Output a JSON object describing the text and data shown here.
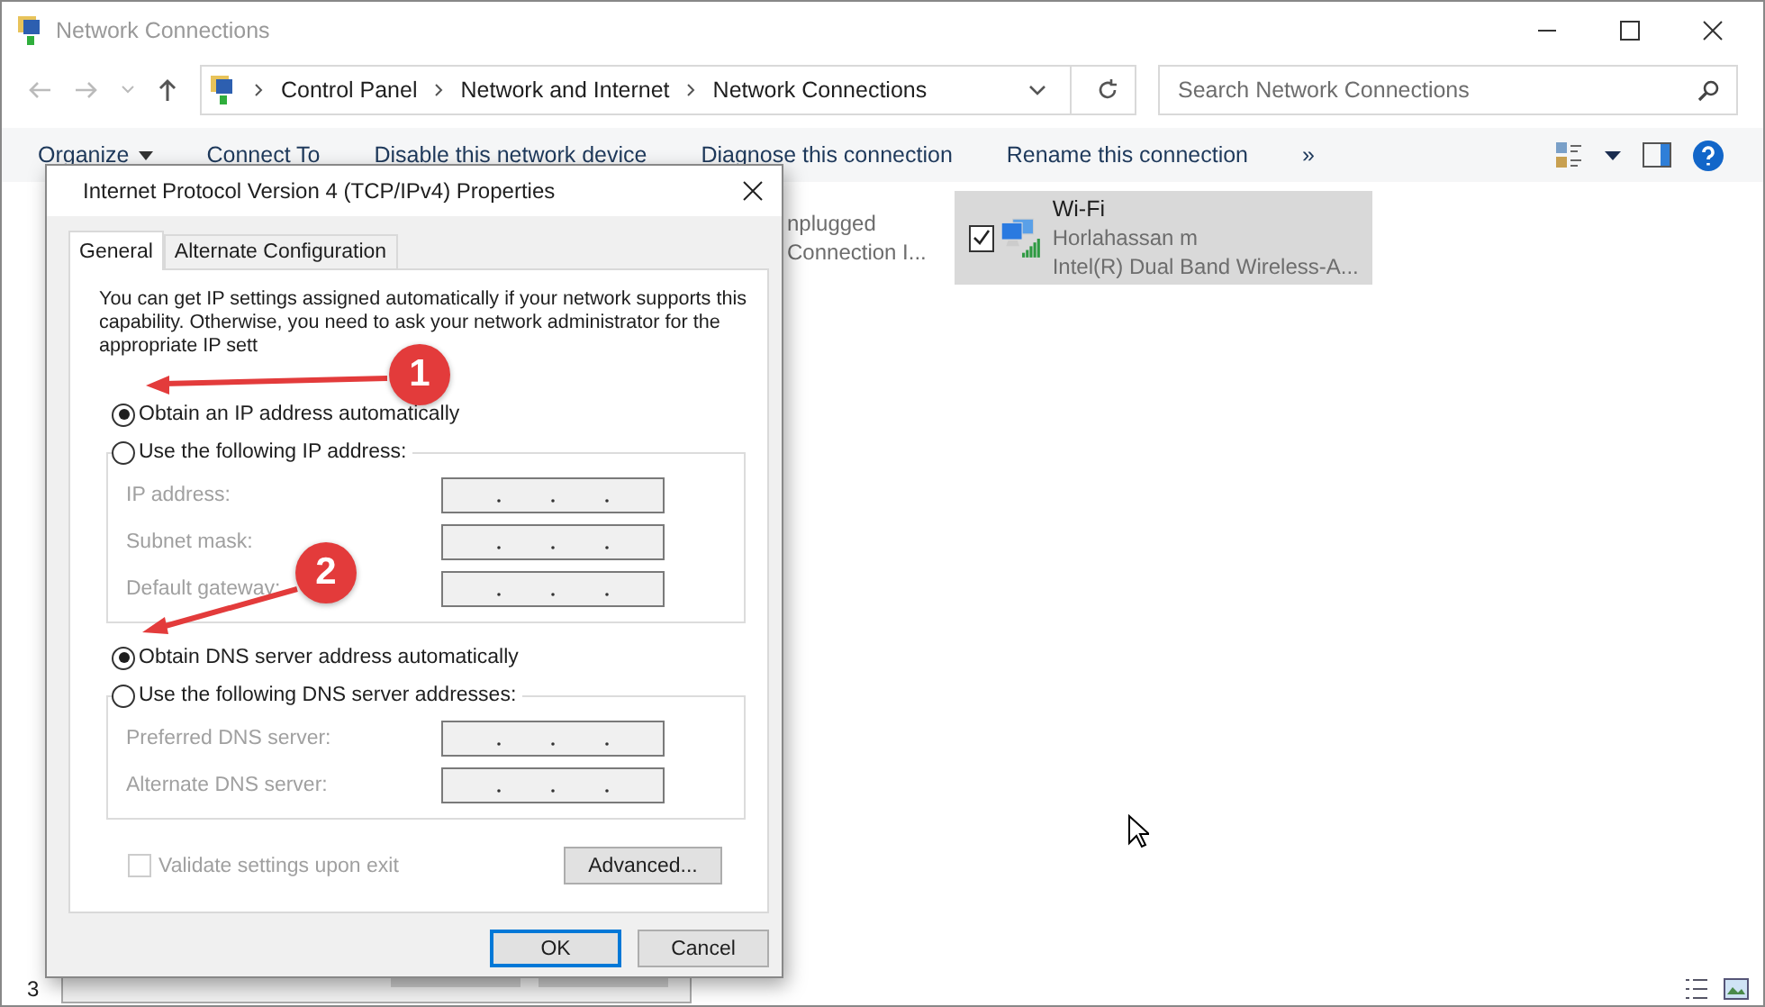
{
  "window": {
    "title": "Network Connections"
  },
  "address_bar": {
    "breadcrumbs": [
      "Control Panel",
      "Network and Internet",
      "Network Connections"
    ]
  },
  "search": {
    "placeholder": "Search Network Connections"
  },
  "toolbar": {
    "items": [
      {
        "label": "Organize",
        "kind": "menu"
      },
      {
        "label": "Connect To",
        "kind": "plain"
      },
      {
        "label": "Disable this network device",
        "kind": "plain"
      },
      {
        "label": "Diagnose this connection",
        "kind": "plain"
      },
      {
        "label": "Rename this connection",
        "kind": "plain"
      },
      {
        "label": "»",
        "kind": "plain"
      }
    ]
  },
  "connections": [
    {
      "lines": [
        "nplugged",
        "Connection I..."
      ],
      "selected": false,
      "kind": "partial"
    },
    {
      "name": "Wi-Fi",
      "lines": [
        "Horlahassan m",
        "Intel(R) Dual Band Wireless-A..."
      ],
      "selected": true,
      "checked": true,
      "kind": "wifi"
    }
  ],
  "dialog": {
    "title": "Internet Protocol Version 4 (TCP/IPv4) Properties",
    "tabs": [
      {
        "label": "General",
        "selected": true
      },
      {
        "label": "Alternate Configuration",
        "selected": false
      }
    ],
    "intro": "You can get IP settings assigned automatically if your network supports this capability. Otherwise, you need to ask your network administrator for the appropriate IP sett",
    "ip_options": [
      {
        "label": "Obtain an IP address automatically",
        "selected": true
      },
      {
        "label": "Use the following IP address:",
        "selected": false
      }
    ],
    "ip_fields": [
      {
        "label": "IP address:",
        "disabled": true
      },
      {
        "label": "Subnet mask:",
        "disabled": true
      },
      {
        "label": "Default gateway:",
        "disabled": true
      }
    ],
    "dns_options": [
      {
        "label": "Obtain DNS server address automatically",
        "selected": true
      },
      {
        "label": "Use the following DNS server addresses:",
        "selected": false
      }
    ],
    "dns_fields": [
      {
        "label": "Preferred DNS server:",
        "disabled": true
      },
      {
        "label": "Alternate DNS server:",
        "disabled": true
      }
    ],
    "validate": {
      "label": "Validate settings upon exit",
      "checked": false,
      "disabled": true
    },
    "advanced_button": "Advanced...",
    "buttons": [
      {
        "label": "OK",
        "selected": true
      },
      {
        "label": "Cancel",
        "selected": false
      }
    ]
  },
  "annotations": [
    {
      "label": "1"
    },
    {
      "label": "2"
    }
  ],
  "status_bar": {
    "item_count": "3"
  }
}
